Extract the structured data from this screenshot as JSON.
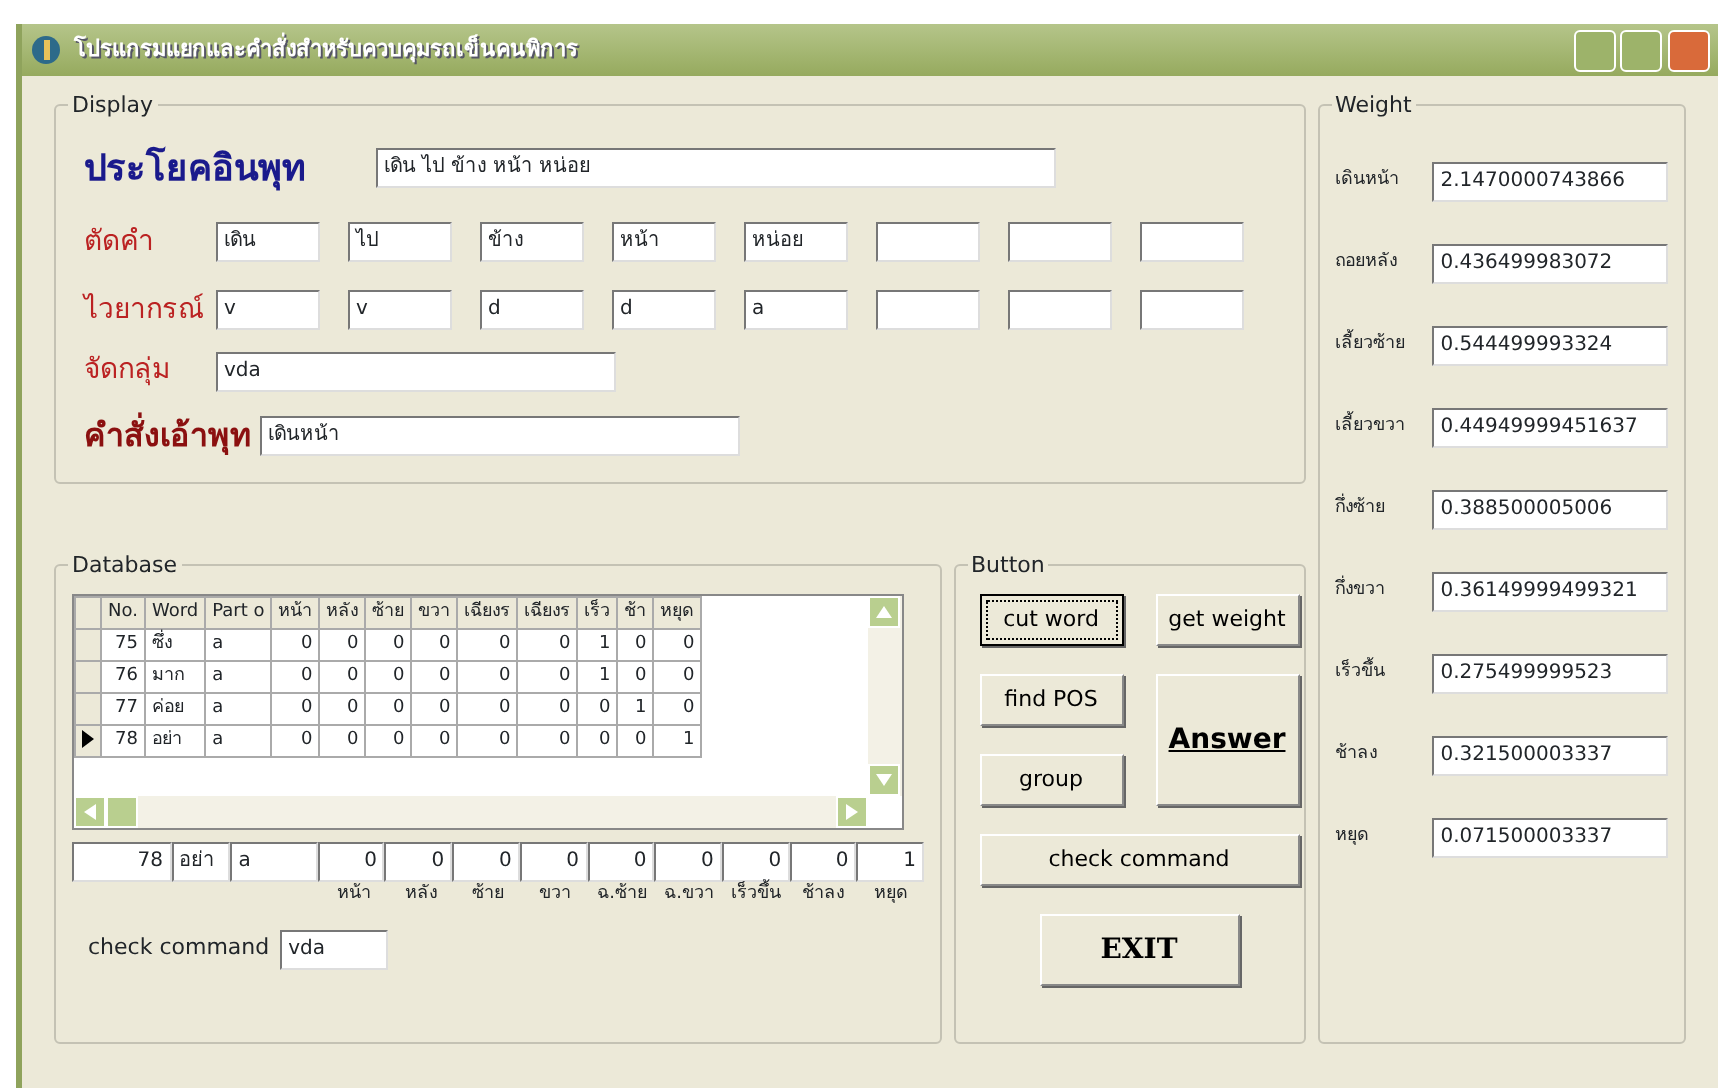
{
  "window": {
    "title": "โปรแกรมแยกและคำสั่งสำหรับควบคุมรถเข็นคนพิการ"
  },
  "display": {
    "title": "Display",
    "input": {
      "label": "ประโยคอินพุท",
      "value": "เดิน ไป ข้าง หน้า หน่อย"
    },
    "segments": {
      "label": "ตัดคำ",
      "fields": [
        {
          "kind": "text",
          "value": "เดิน"
        },
        {
          "kind": "text",
          "value": "ไป"
        },
        {
          "kind": "text",
          "value": "ข้าง"
        },
        {
          "kind": "text",
          "value": "หน้า"
        },
        {
          "kind": "text",
          "value": "หน่อย"
        },
        {
          "kind": "blank"
        },
        {
          "kind": "blank"
        },
        {
          "kind": "blank"
        }
      ]
    },
    "grammar": {
      "label": "ไวยากรณ์",
      "fields": [
        {
          "kind": "text",
          "value": "v"
        },
        {
          "kind": "text",
          "value": "v"
        },
        {
          "kind": "text",
          "value": "d"
        },
        {
          "kind": "text",
          "value": "d"
        },
        {
          "kind": "text",
          "value": "a"
        },
        {
          "kind": "blank"
        },
        {
          "kind": "blank"
        },
        {
          "kind": "blank"
        }
      ]
    },
    "group": {
      "label": "จัดกลุ่ม",
      "value": "vda"
    },
    "command": {
      "label": "คำสั่งเอ้าพุท",
      "value": "เดินหน้า"
    }
  },
  "database": {
    "title": "Database",
    "columns": [
      "No.",
      "Word",
      "Part o",
      "หน้า",
      "หลัง",
      "ซ้าย",
      "ขวา",
      "เฉียงร",
      "เฉียงร",
      "เร็ว",
      "ช้า",
      "หยุด"
    ],
    "rows": [
      {
        "selected": false,
        "cells": [
          "75",
          "ซึ่ง",
          "a",
          "0",
          "0",
          "0",
          "0",
          "0",
          "0",
          "1",
          "0",
          "0"
        ]
      },
      {
        "selected": false,
        "cells": [
          "76",
          "มาก",
          "a",
          "0",
          "0",
          "0",
          "0",
          "0",
          "0",
          "1",
          "0",
          "0"
        ]
      },
      {
        "selected": false,
        "cells": [
          "77",
          "ค่อย",
          "a",
          "0",
          "0",
          "0",
          "0",
          "0",
          "0",
          "0",
          "1",
          "0"
        ]
      },
      {
        "selected": true,
        "cells": [
          "78",
          "อย่า",
          "a",
          "0",
          "0",
          "0",
          "0",
          "0",
          "0",
          "0",
          "0",
          "1"
        ]
      }
    ],
    "record": [
      "78",
      "อย่า",
      "a",
      "0",
      "0",
      "0",
      "0",
      "0",
      "0",
      "0",
      "0",
      "1"
    ],
    "record_labels": [
      "หน้า",
      "หลัง",
      "ซ้าย",
      "ขวา",
      "ฉ.ซ้าย",
      "ฉ.ขวา",
      "เร็วขึ้น",
      "ช้าลง",
      "หยุด"
    ],
    "check_command": {
      "label": "check command",
      "value": "vda"
    }
  },
  "buttons": {
    "title": "Button",
    "items": [
      {
        "label": "cut word",
        "kind": "normal",
        "focused": true
      },
      {
        "label": "get weight",
        "kind": "normal",
        "focused": false
      },
      {
        "label": "find POS",
        "kind": "normal",
        "focused": false
      },
      {
        "label": "Answer",
        "kind": "tall",
        "focused": false
      },
      {
        "label": "group",
        "kind": "normal",
        "focused": false
      },
      {
        "label": "check command",
        "kind": "wide",
        "focused": false
      },
      {
        "label": "EXIT",
        "kind": "exit",
        "focused": false
      }
    ]
  },
  "weight": {
    "title": "Weight",
    "items": [
      {
        "label": "เดินหน้า",
        "value": "2.1470000743866"
      },
      {
        "label": "ถอยหลัง",
        "value": "0.436499983072"
      },
      {
        "label": "เลี้ยวซ้าย",
        "value": "0.544499993324"
      },
      {
        "label": "เลี้ยวขวา",
        "value": "0.44949999451637"
      },
      {
        "label": "กึ่งซ้าย",
        "value": "0.388500005006"
      },
      {
        "label": "กึ่งขวา",
        "value": "0.36149999499321"
      },
      {
        "label": "เร็วขึ้น",
        "value": "0.275499999523"
      },
      {
        "label": "ช้าลง",
        "value": "0.321500003337"
      },
      {
        "label": "หยุด",
        "value": "0.071500003337"
      }
    ]
  }
}
